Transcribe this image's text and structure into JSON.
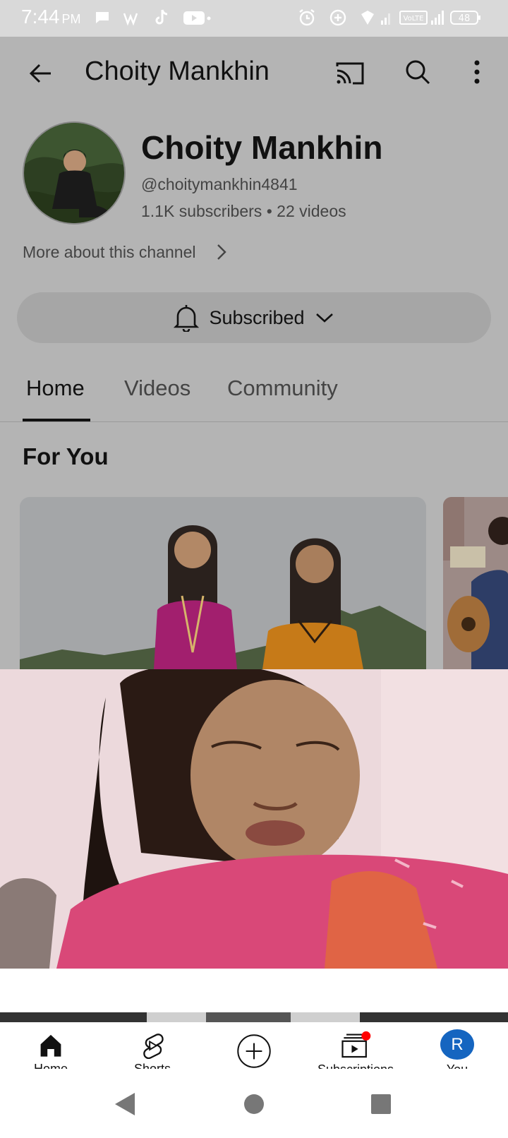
{
  "status_bar": {
    "time": "7:44",
    "ampm": "PM",
    "battery": "48"
  },
  "app_bar": {
    "title": "Choity Mankhin"
  },
  "channel": {
    "name": "Choity Mankhin",
    "handle": "@choitymankhin4841",
    "subscribers": "1.1K subscribers",
    "videos": "22 videos",
    "more_about": "More about this channel"
  },
  "subscribe_button": {
    "label": "Subscribed"
  },
  "tabs": [
    {
      "label": "Home",
      "active": true
    },
    {
      "label": "Videos",
      "active": false
    },
    {
      "label": "Community",
      "active": false
    }
  ],
  "section": {
    "title": "For You"
  },
  "bottom_nav": {
    "items": [
      {
        "label": "Home",
        "icon": "home-icon"
      },
      {
        "label": "Shorts",
        "icon": "shorts-icon"
      },
      {
        "label": "",
        "icon": "create-icon"
      },
      {
        "label": "Subscriptions",
        "icon": "subscriptions-icon"
      },
      {
        "label": "You",
        "icon": "avatar-icon",
        "avatar_letter": "R"
      }
    ]
  },
  "colors": {
    "background_dimmed": "#b4b4b4",
    "avatar_blue": "#1565c0",
    "notification_red": "#ff0000"
  }
}
